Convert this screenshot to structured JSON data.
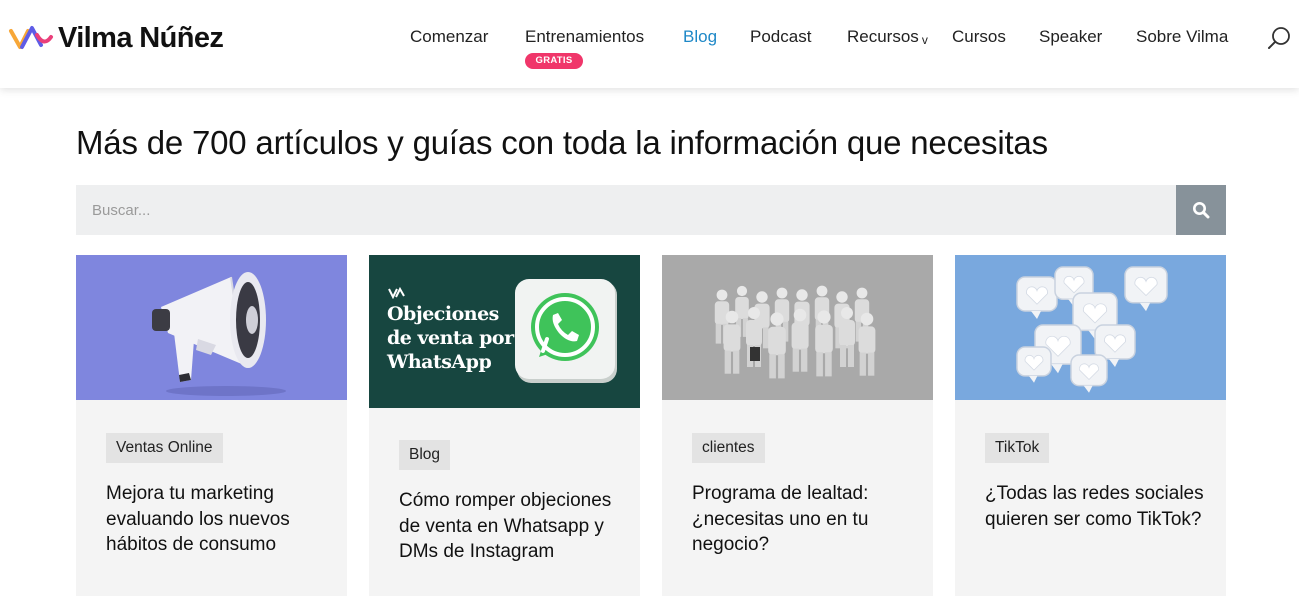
{
  "brand": {
    "name": "Vilma Núñez"
  },
  "nav": {
    "items": [
      {
        "label": "Comenzar"
      },
      {
        "label": "Entrenamientos",
        "badge": "GRATIS"
      },
      {
        "label": "Blog",
        "active": true
      },
      {
        "label": "Podcast"
      },
      {
        "label": "Recursos",
        "has_dropdown": true
      },
      {
        "label": "Cursos"
      },
      {
        "label": "Speaker"
      },
      {
        "label": "Sobre Vilma"
      }
    ],
    "search_icon": "search-icon"
  },
  "main": {
    "title": "Más de 700 artículos y guías con toda la información que necesitas",
    "search": {
      "placeholder": "Buscar...",
      "value": ""
    }
  },
  "cards": [
    {
      "tag": "Ventas Online",
      "title": "Mejora tu marketing evaluando los nuevos hábitos de consumo",
      "image": "megaphone-illustration",
      "image_bg": "#7f86de"
    },
    {
      "tag": "Blog",
      "title": "Cómo romper objeciones de venta en Whatsapp y DMs de Instagram",
      "image_text": "Objeciones de venta por WhatsApp",
      "image": "whatsapp-illustration",
      "image_bg": "#174640"
    },
    {
      "tag": "clientes",
      "title": "Programa de lealtad: ¿necesitas uno en tu negocio?",
      "image": "crowd-figures-illustration",
      "image_bg": "#a9a9a9"
    },
    {
      "tag": "TikTok",
      "title": "¿Todas las redes sociales quieren ser como TikTok?",
      "image": "hearts-illustration",
      "image_bg": "#79a8de"
    }
  ],
  "colors": {
    "accent": "#1e88c7",
    "badge": "#f0366a",
    "search_button": "#87929a"
  }
}
